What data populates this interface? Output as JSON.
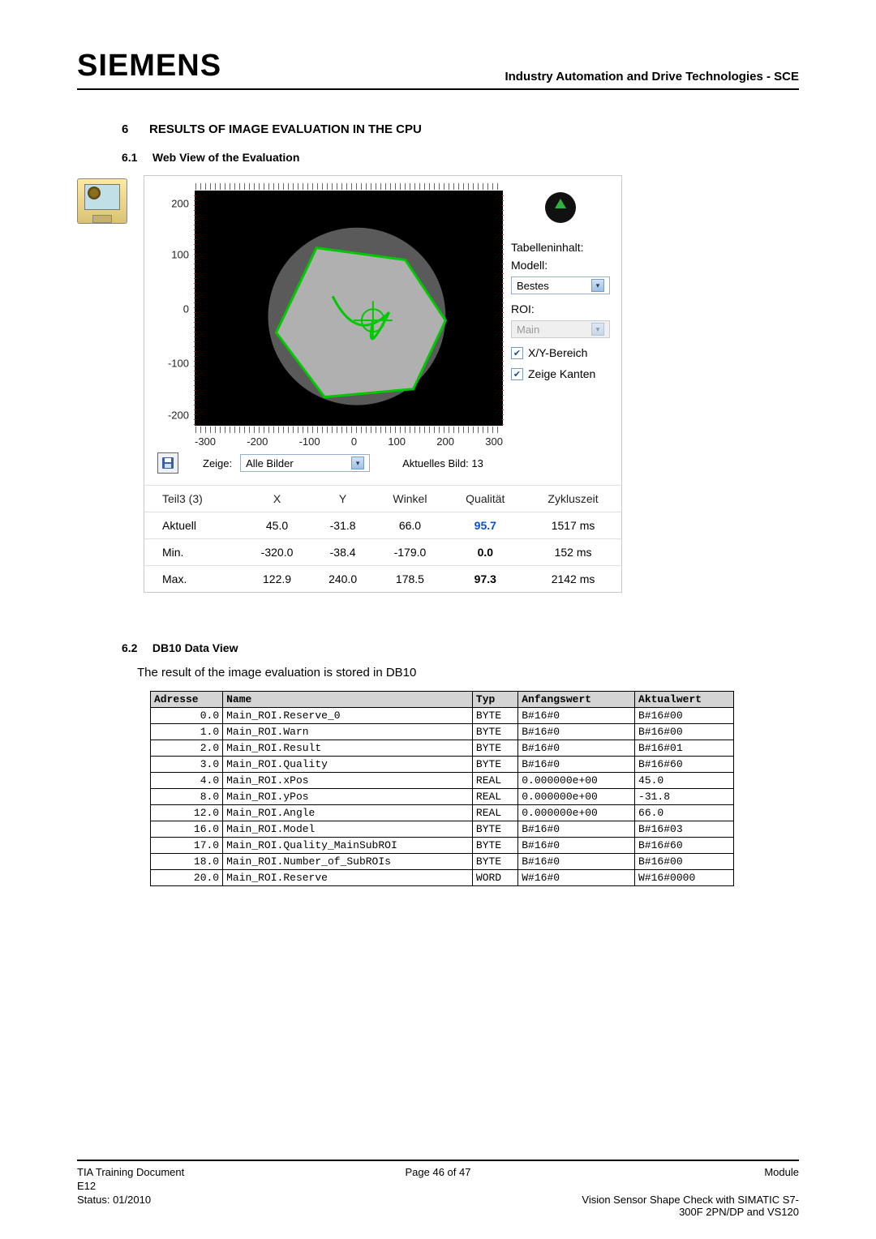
{
  "header": {
    "logo": "SIEMENS",
    "right": "Industry Automation and Drive Technologies - SCE"
  },
  "section": {
    "num": "6",
    "title": "RESULTS OF IMAGE EVALUATION IN THE CPU"
  },
  "sub1": {
    "num": "6.1",
    "title": "Web View of the Evaluation"
  },
  "sub2": {
    "num": "6.2",
    "title": "DB10 Data View",
    "text": "The result of the image evaluation is stored in DB10"
  },
  "webview": {
    "right_labels": {
      "table_content": "Tabelleninhalt:",
      "model": "Modell:",
      "model_value": "Bestes",
      "roi": "ROI:",
      "roi_value": "Main",
      "xy_range": "X/Y-Bereich",
      "show_edges": "Zeige Kanten"
    },
    "bottom": {
      "zeige_label": "Zeige:",
      "zeige_value": "Alle Bilder",
      "current_label": "Aktuelles Bild:",
      "current_value": "13"
    },
    "results": {
      "headers": [
        "Teil3 (3)",
        "X",
        "Y",
        "Winkel",
        "Qualität",
        "Zykluszeit"
      ],
      "rows": [
        {
          "label": "Aktuell",
          "x": "45.0",
          "y": "-31.8",
          "w": "66.0",
          "q": "95.7",
          "t": "1517 ms"
        },
        {
          "label": "Min.",
          "x": "-320.0",
          "y": "-38.4",
          "w": "-179.0",
          "q": "0.0",
          "t": "152 ms"
        },
        {
          "label": "Max.",
          "x": "122.9",
          "y": "240.0",
          "w": "178.5",
          "q": "97.3",
          "t": "2142 ms"
        }
      ]
    }
  },
  "db10": {
    "headers": [
      "Adresse",
      "Name",
      "Typ",
      "Anfangswert",
      "Aktualwert"
    ],
    "rows": [
      {
        "addr": "0.0",
        "name": "Main_ROI.Reserve_0",
        "typ": "BYTE",
        "anf": "B#16#0",
        "akt": "B#16#00"
      },
      {
        "addr": "1.0",
        "name": "Main_ROI.Warn",
        "typ": "BYTE",
        "anf": "B#16#0",
        "akt": "B#16#00"
      },
      {
        "addr": "2.0",
        "name": "Main_ROI.Result",
        "typ": "BYTE",
        "anf": "B#16#0",
        "akt": "B#16#01"
      },
      {
        "addr": "3.0",
        "name": "Main_ROI.Quality",
        "typ": "BYTE",
        "anf": "B#16#0",
        "akt": "B#16#60"
      },
      {
        "addr": "4.0",
        "name": "Main_ROI.xPos",
        "typ": "REAL",
        "anf": "0.000000e+00",
        "akt": "45.0"
      },
      {
        "addr": "8.0",
        "name": "Main_ROI.yPos",
        "typ": "REAL",
        "anf": "0.000000e+00",
        "akt": "-31.8"
      },
      {
        "addr": "12.0",
        "name": "Main_ROI.Angle",
        "typ": "REAL",
        "anf": "0.000000e+00",
        "akt": "66.0"
      },
      {
        "addr": "16.0",
        "name": "Main_ROI.Model",
        "typ": "BYTE",
        "anf": "B#16#0",
        "akt": "B#16#03"
      },
      {
        "addr": "17.0",
        "name": "Main_ROI.Quality_MainSubROI",
        "typ": "BYTE",
        "anf": "B#16#0",
        "akt": "B#16#60"
      },
      {
        "addr": "18.0",
        "name": "Main_ROI.Number_of_SubROIs",
        "typ": "BYTE",
        "anf": "B#16#0",
        "akt": "B#16#00"
      },
      {
        "addr": "20.0",
        "name": "Main_ROI.Reserve",
        "typ": "WORD",
        "anf": "W#16#0",
        "akt": "W#16#0000"
      }
    ]
  },
  "chart_data": {
    "type": "scatter",
    "title": "",
    "xlabel": "",
    "ylabel": "",
    "x_ticks": [
      -300,
      -200,
      -100,
      0,
      100,
      200,
      300
    ],
    "y_ticks": [
      -200,
      -100,
      0,
      100,
      200
    ],
    "xlim": [
      -330,
      330
    ],
    "ylim": [
      -240,
      240
    ],
    "detected_shape": "hexagon",
    "center": {
      "x": 45.0,
      "y": -31.8
    },
    "angle_deg": 66.0,
    "hexagon_vertices_approx": [
      {
        "x": -60,
        "y": 100
      },
      {
        "x": 80,
        "y": 120
      },
      {
        "x": 170,
        "y": 20
      },
      {
        "x": 120,
        "y": -110
      },
      {
        "x": -20,
        "y": -130
      },
      {
        "x": -110,
        "y": -30
      }
    ],
    "edge_color": "#00c800",
    "background": "black"
  },
  "footer": {
    "l1": "TIA  Training Document",
    "c1": "Page 46 of 47",
    "r1": "Module",
    "l2": "E12",
    "l3": "Status: 01/2010",
    "r3": "Vision Sensor Shape Check with SIMATIC S7-300F 2PN/DP and VS120"
  }
}
